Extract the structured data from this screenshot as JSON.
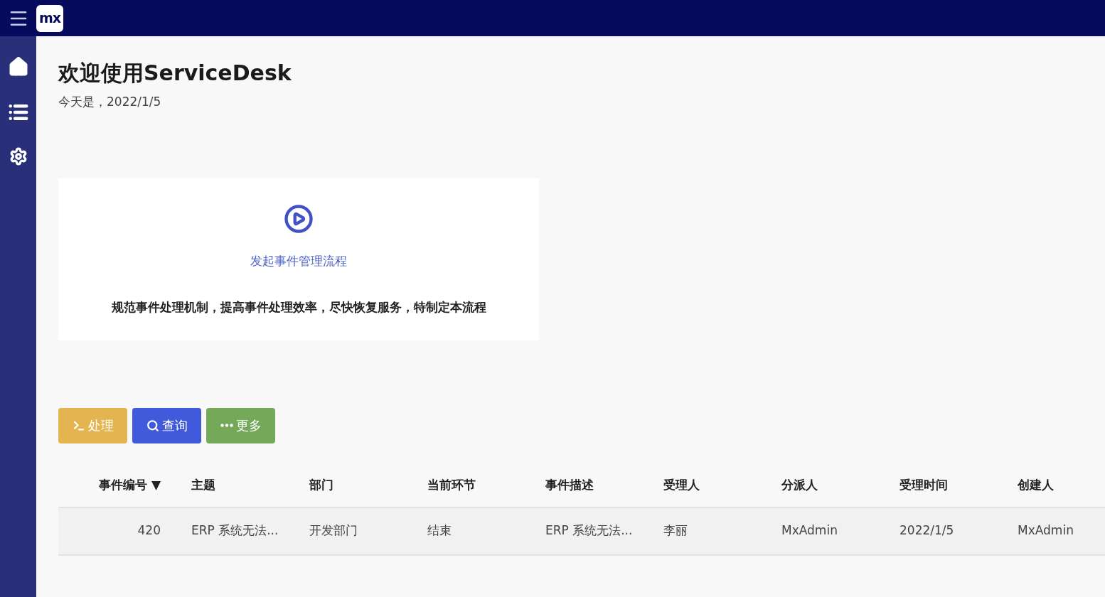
{
  "header": {
    "logo": "mx"
  },
  "page": {
    "title": "欢迎使用ServiceDesk",
    "subtitle": "今天是，2022/1/5"
  },
  "card": {
    "link": "发起事件管理流程",
    "description": "规范事件处理机制，提高事件处理效率，尽快恢复服务，特制定本流程"
  },
  "buttons": [
    {
      "kind": "process",
      "label": "处理",
      "color": "#e3b450"
    },
    {
      "kind": "search",
      "label": "查询",
      "color": "#4159db"
    },
    {
      "kind": "more",
      "label": "更多",
      "color": "#74a95a"
    }
  ],
  "table": {
    "sort_indicator": "▼",
    "columns": [
      "事件编号",
      "主题",
      "部门",
      "当前环节",
      "事件描述",
      "受理人",
      "分派人",
      "受理时间",
      "创建人"
    ],
    "rows": [
      [
        "420",
        "ERP 系统无法...",
        "开发部门",
        "结束",
        "ERP 系统无法...",
        "李丽",
        "MxAdmin",
        "2022/1/5",
        "MxAdmin"
      ]
    ]
  }
}
